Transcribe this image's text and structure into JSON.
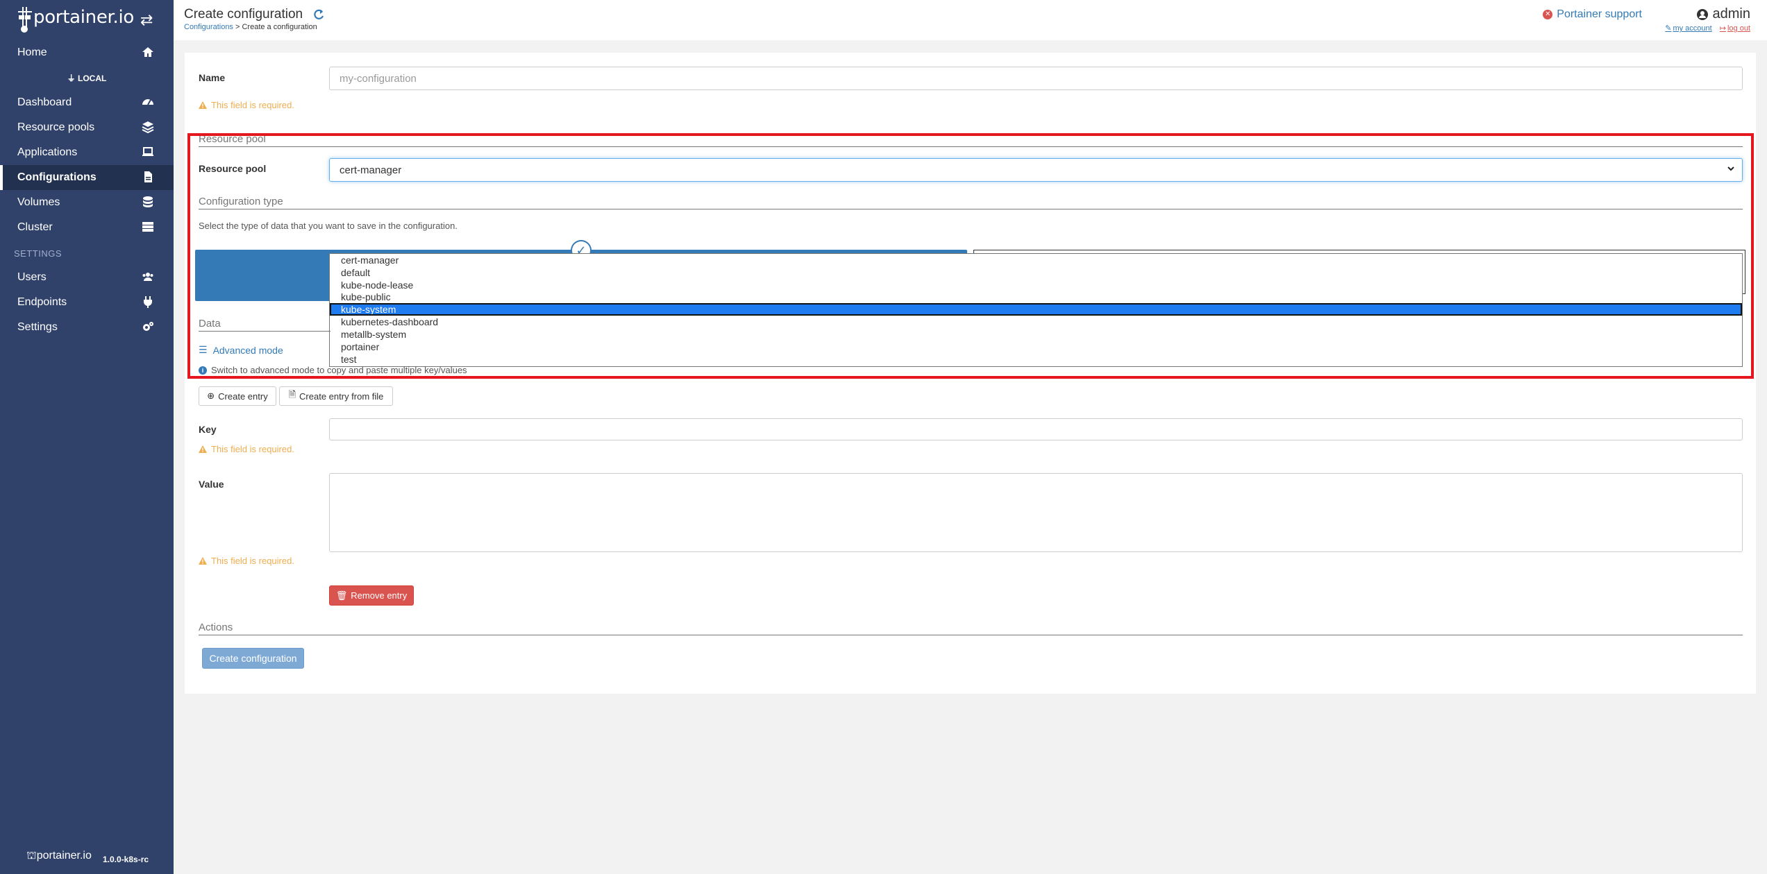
{
  "sidebar": {
    "logo_text": "portainer.io",
    "items": [
      {
        "label": "Home"
      },
      {
        "label": "Dashboard"
      },
      {
        "label": "Resource pools"
      },
      {
        "label": "Applications"
      },
      {
        "label": "Configurations"
      },
      {
        "label": "Volumes"
      },
      {
        "label": "Cluster"
      }
    ],
    "environment": "LOCAL",
    "settings_section": "SETTINGS",
    "settings_items": [
      {
        "label": "Users"
      },
      {
        "label": "Endpoints"
      },
      {
        "label": "Settings"
      }
    ],
    "footer_logo": "portainer.io",
    "version": "1.0.0-k8s-rc"
  },
  "header": {
    "title": "Create configuration",
    "breadcrumb_link": "Configurations",
    "breadcrumb_rest": " > Create a configuration",
    "support": "Portainer support",
    "user": "admin",
    "my_account": "my account",
    "log_out": "log out"
  },
  "form": {
    "name_label": "Name",
    "name_placeholder": "my-configuration",
    "required_msg": "This field is required.",
    "resource_pool_section": "Resource pool",
    "resource_pool_label": "Resource pool",
    "resource_pool_value": "cert-manager",
    "config_type_section": "Configuration type",
    "config_type_help": "Select the type of data that you want to save in the configuration.",
    "resource_pool_options": [
      "cert-manager",
      "default",
      "kube-node-lease",
      "kube-public",
      "kube-system",
      "kubernetes-dashboard",
      "metallb-system",
      "portainer",
      "test"
    ],
    "highlighted_option": "kube-system",
    "data_section": "Data",
    "advanced_mode": "Advanced mode",
    "advanced_help": "Switch to advanced mode to copy and paste multiple key/values",
    "create_entry": "Create entry",
    "create_entry_file": "Create entry from file",
    "key_label": "Key",
    "value_label": "Value",
    "remove_entry": "Remove entry",
    "actions_section": "Actions",
    "create_configuration": "Create configuration"
  }
}
